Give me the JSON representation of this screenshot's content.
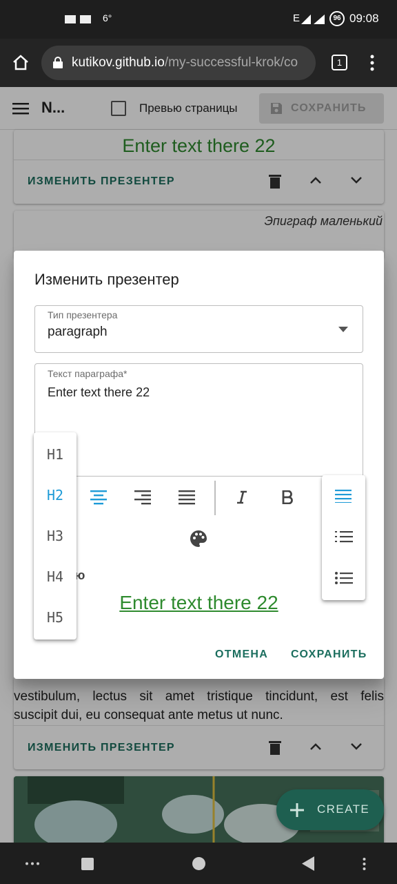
{
  "status": {
    "weather": "6°",
    "signal": "E",
    "battery": "96",
    "time": "09:08"
  },
  "browser": {
    "url_host": "kutikov.github.io",
    "url_path": "/my-successful-krok/co",
    "tab_count": "1"
  },
  "appbar": {
    "title": "N...",
    "preview_label": "Превью страницы",
    "save_label": "СОХРАНИТЬ"
  },
  "cards": {
    "heading": "Enter text there 22",
    "edit_label": "ИЗМЕНИТЬ ПРЕЗЕНТЕР",
    "epigraph": "Эпиграф маленький",
    "body_line1": "vestibulum, lectus sit amet tristique tincidunt, est felis",
    "body_line2": "suscipit dui, eu consequat ante metus ut nunc.",
    "edit_label_3": "ИЗМЕНИТЬ ПРЕЗЕНТЕР"
  },
  "dialog": {
    "title": "Изменить презентер",
    "type_label": "Тип презентера",
    "type_value": "paragraph",
    "text_label": "Текст параграфа*",
    "text_value": "Enter text there 22",
    "partial_label": "ю",
    "preview_text": "Enter text there 22",
    "cancel": "ОТМЕНА",
    "save": "СОХРАНИТЬ"
  },
  "heading_menu": {
    "items": [
      "H1",
      "H2",
      "H3",
      "H4",
      "H5"
    ],
    "selected": "H2"
  },
  "list_menu": {
    "items": [
      "align-justify-icon",
      "numbered-list-icon",
      "bullet-list-icon"
    ],
    "selected": "align-justify-icon"
  },
  "fab": {
    "label": "CREATE"
  },
  "colors": {
    "accent": "#1e9bd7",
    "teal": "#1b6e5e",
    "green_text": "#2e8a2e"
  }
}
